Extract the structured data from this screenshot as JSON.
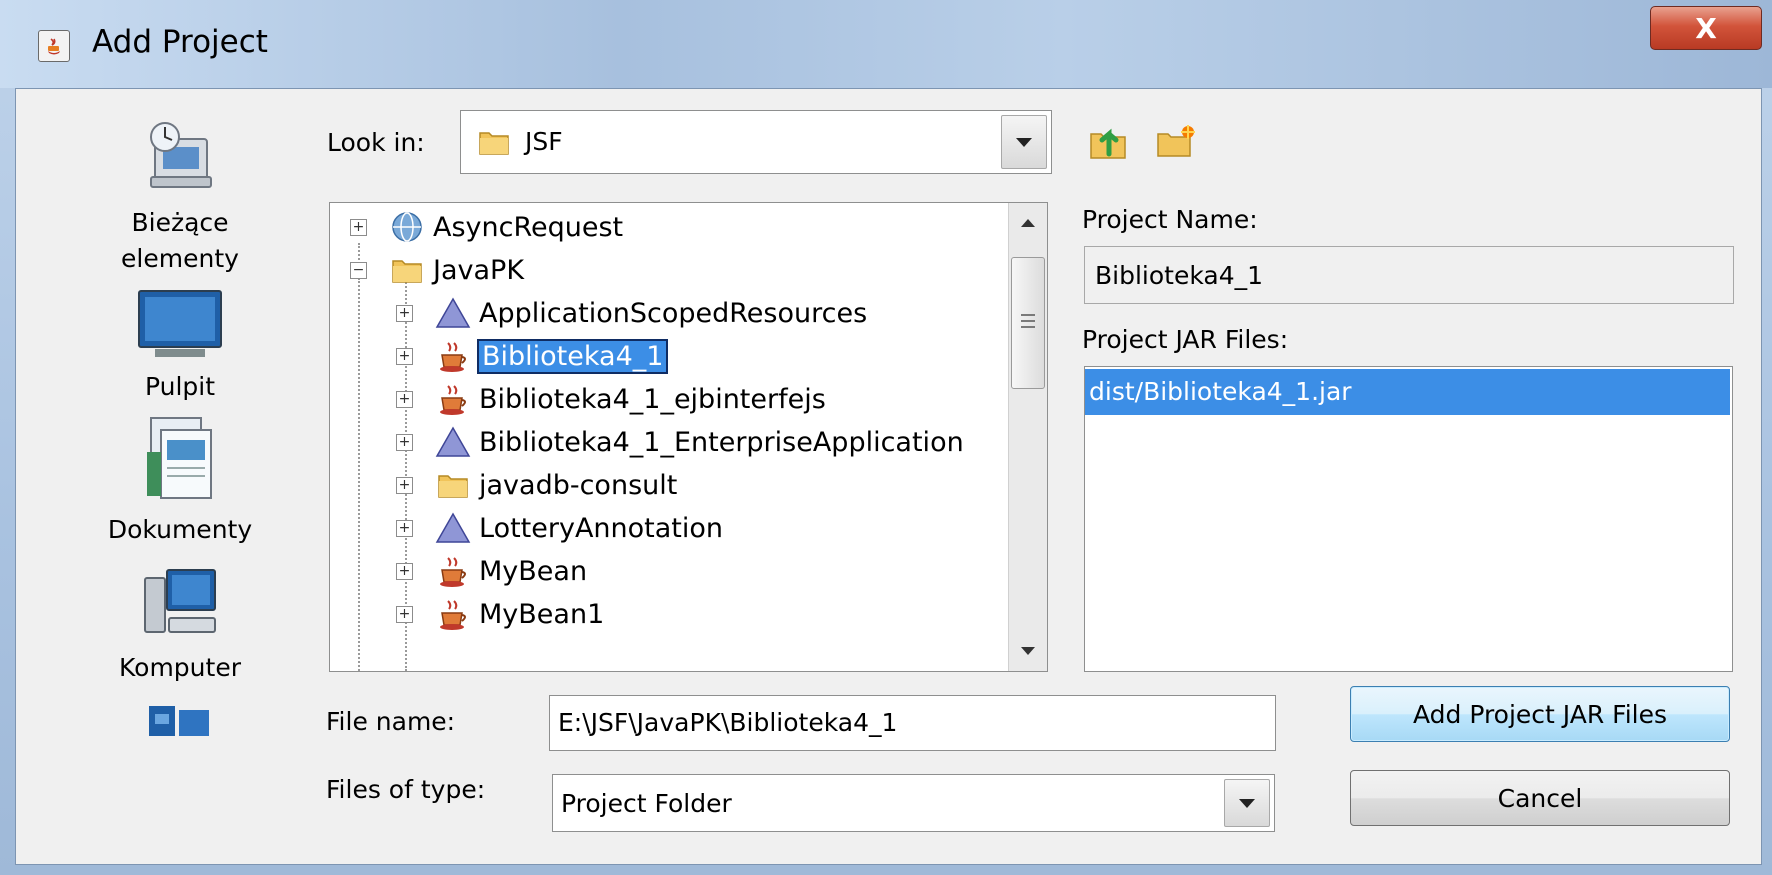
{
  "window": {
    "title": "Add Project",
    "close_label": "X"
  },
  "places": [
    {
      "label_line1": "Bieżące",
      "label_line2": "elementy",
      "icon": "recent-items-icon"
    },
    {
      "label_line1": "Pulpit",
      "label_line2": "",
      "icon": "desktop-icon"
    },
    {
      "label_line1": "Dokumenty",
      "label_line2": "",
      "icon": "documents-icon"
    },
    {
      "label_line1": "Komputer",
      "label_line2": "",
      "icon": "computer-icon"
    },
    {
      "label_line1": "",
      "label_line2": "",
      "icon": "network-icon"
    }
  ],
  "look_in": {
    "label": "Look in:",
    "value": "JSF"
  },
  "toolbar": {
    "up_icon": "up-one-level-icon",
    "new_folder_icon": "new-folder-icon"
  },
  "tree": {
    "items": [
      {
        "label": "AsyncRequest",
        "icon": "web-project-icon",
        "expander": "+",
        "level": 0
      },
      {
        "label": "JavaPK",
        "icon": "folder-icon",
        "expander": "−",
        "level": 0
      },
      {
        "label": "ApplicationScopedResources",
        "icon": "enterprise-triangle-icon",
        "expander": "+",
        "level": 1
      },
      {
        "label": "Biblioteka4_1",
        "icon": "java-cup-icon",
        "expander": "+",
        "level": 1,
        "selected": true
      },
      {
        "label": "Biblioteka4_1_ejbinterfejs",
        "icon": "java-cup-icon",
        "expander": "+",
        "level": 1
      },
      {
        "label": "Biblioteka4_1_EnterpriseApplication",
        "icon": "enterprise-triangle-icon",
        "expander": "+",
        "level": 1
      },
      {
        "label": "javadb-consult",
        "icon": "folder-icon",
        "expander": "+",
        "level": 1
      },
      {
        "label": "LotteryAnnotation",
        "icon": "enterprise-triangle-icon",
        "expander": "+",
        "level": 1
      },
      {
        "label": "MyBean",
        "icon": "java-cup-icon",
        "expander": "+",
        "level": 1
      },
      {
        "label": "MyBean1",
        "icon": "java-cup-icon",
        "expander": "+",
        "level": 1
      }
    ]
  },
  "project_name": {
    "label": "Project Name:",
    "value": "Biblioteka4_1"
  },
  "project_jars": {
    "label": "Project JAR Files:",
    "items": [
      "dist/Biblioteka4_1.jar"
    ]
  },
  "file_name": {
    "label": "File name:",
    "value": "E:\\JSF\\JavaPK\\Biblioteka4_1"
  },
  "files_of_type": {
    "label": "Files of type:",
    "value": "Project Folder"
  },
  "buttons": {
    "add_jar": "Add Project JAR Files",
    "cancel": "Cancel"
  },
  "colors": {
    "selection": "#3c8ee6",
    "titlebar": "#a7c0de",
    "close": "#d2543b"
  }
}
